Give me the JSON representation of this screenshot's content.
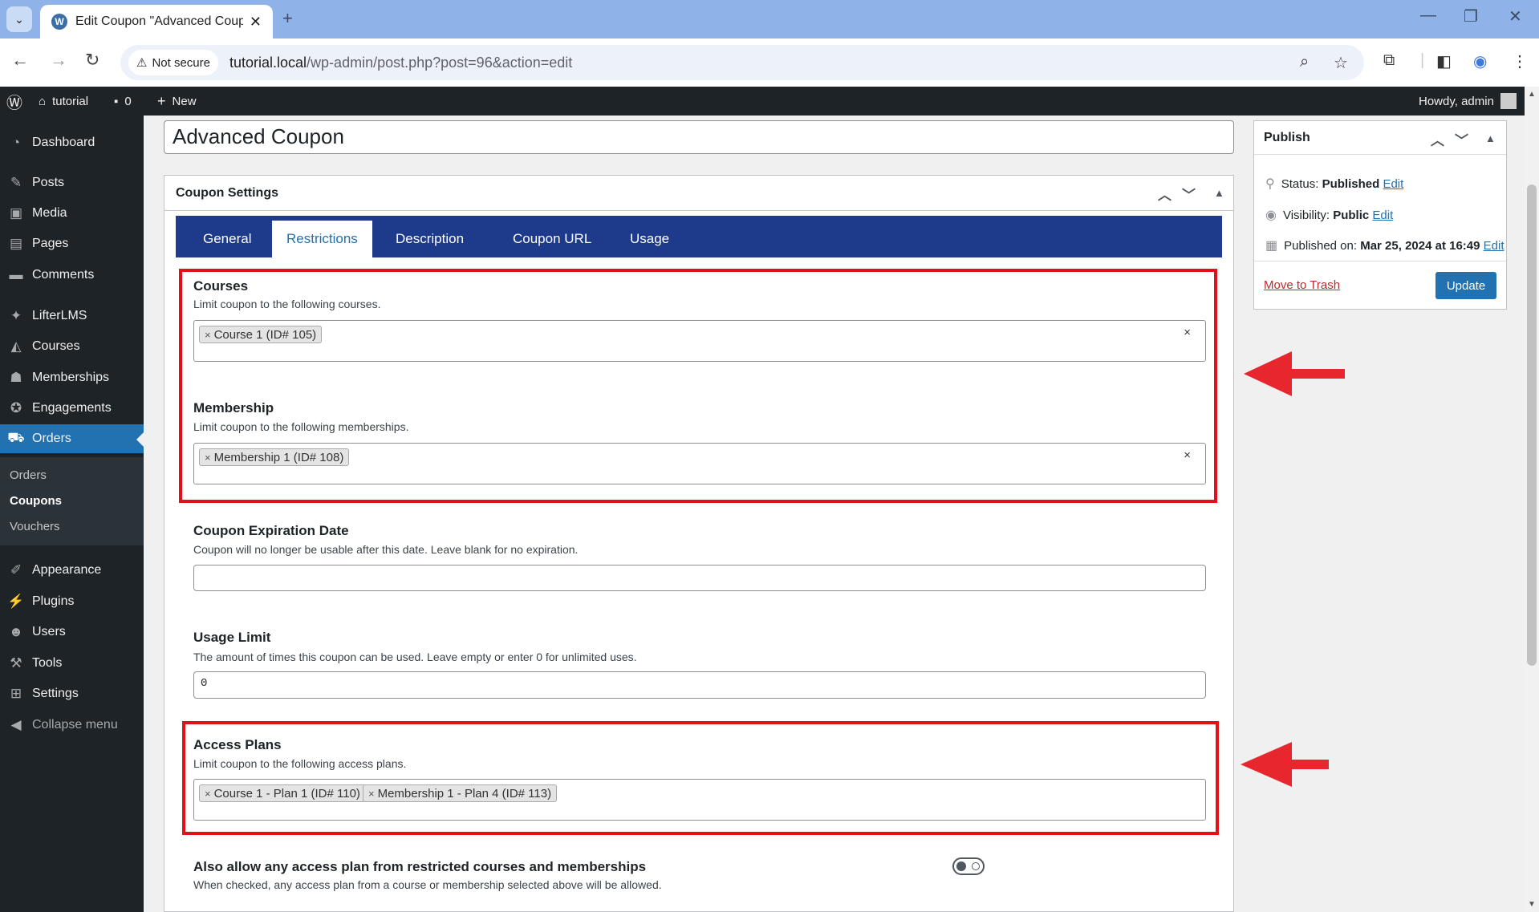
{
  "browser": {
    "tab_title": "Edit Coupon \"Advanced Coupo",
    "url_host": "tutorial.local",
    "url_path": "/wp-admin/post.php?post=96&action=edit",
    "security_label": "Not secure",
    "tab_close": "✕",
    "new_tab": "+"
  },
  "adminbar": {
    "site_name": "tutorial",
    "comments_count": "0",
    "new_label": "New",
    "howdy": "Howdy, admin"
  },
  "sidebar": {
    "items": [
      {
        "label": "Dashboard",
        "icon": "dashboard-icon"
      },
      {
        "label": "Posts",
        "icon": "pin-icon"
      },
      {
        "label": "Media",
        "icon": "media-icon"
      },
      {
        "label": "Pages",
        "icon": "page-icon"
      },
      {
        "label": "Comments",
        "icon": "comment-icon"
      },
      {
        "label": "LifterLMS",
        "icon": "rocket-icon"
      },
      {
        "label": "Courses",
        "icon": "courses-icon"
      },
      {
        "label": "Memberships",
        "icon": "group-icon"
      },
      {
        "label": "Engagements",
        "icon": "award-icon"
      },
      {
        "label": "Orders",
        "icon": "cart-icon"
      },
      {
        "label": "Appearance",
        "icon": "brush-icon"
      },
      {
        "label": "Plugins",
        "icon": "plugin-icon"
      },
      {
        "label": "Users",
        "icon": "user-icon"
      },
      {
        "label": "Tools",
        "icon": "wrench-icon"
      },
      {
        "label": "Settings",
        "icon": "settings-icon"
      },
      {
        "label": "Collapse menu",
        "icon": "collapse-icon"
      }
    ],
    "submenu": [
      "Orders",
      "Coupons",
      "Vouchers"
    ]
  },
  "post": {
    "title": "Advanced Coupon"
  },
  "coupon_settings": {
    "heading": "Coupon Settings",
    "tabs": [
      "General",
      "Restrictions",
      "Description",
      "Coupon URL",
      "Usage"
    ],
    "courses": {
      "label": "Courses",
      "desc": "Limit coupon to the following courses.",
      "selected": [
        "Course 1 (ID# 105)"
      ]
    },
    "membership": {
      "label": "Membership",
      "desc": "Limit coupon to the following memberships.",
      "selected": [
        "Membership 1 (ID# 108)"
      ]
    },
    "expiration": {
      "label": "Coupon Expiration Date",
      "desc": "Coupon will no longer be usable after this date. Leave blank for no expiration.",
      "value": ""
    },
    "usage_limit": {
      "label": "Usage Limit",
      "desc": "The amount of times this coupon can be used. Leave empty or enter 0 for unlimited uses.",
      "value": "0"
    },
    "access_plans": {
      "label": "Access Plans",
      "desc": "Limit coupon to the following access plans.",
      "selected": [
        "Course 1 - Plan 1 (ID# 110)",
        "Membership 1 - Plan 4 (ID# 113)"
      ]
    },
    "allow_any": {
      "label": "Also allow any access plan from restricted courses and memberships",
      "desc": "When checked, any access plan from a course or membership selected above will be allowed.",
      "checked": false
    }
  },
  "publish": {
    "heading": "Publish",
    "status_label": "Status:",
    "status_value": "Published",
    "visibility_label": "Visibility:",
    "visibility_value": "Public",
    "published_label": "Published on:",
    "published_value": "Mar 25, 2024 at 16:49",
    "edit": "Edit",
    "trash": "Move to Trash",
    "update": "Update"
  },
  "colors": {
    "highlight": "#e3101a",
    "accent": "#2271b1",
    "tabs_bg": "#1e3a8a"
  }
}
